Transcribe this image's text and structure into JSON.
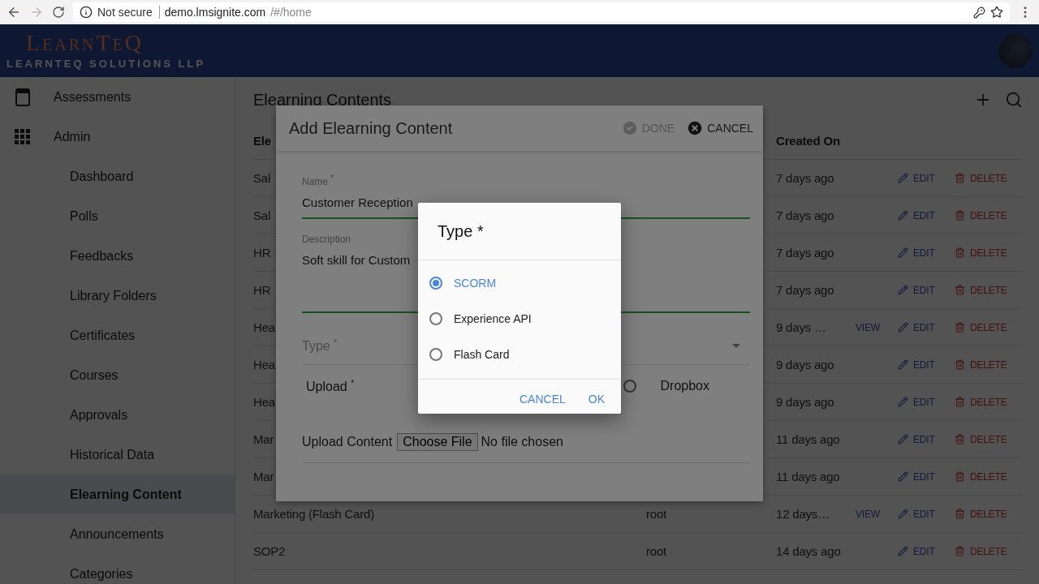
{
  "browser": {
    "security": "Not secure",
    "url_host": "demo.lmsignite.com",
    "url_path": "/#/home",
    "forward_disabled": true
  },
  "app_bar": {
    "logo": "LearnTeQ",
    "tagline": "LEARNTEQ SOLUTIONS LLP"
  },
  "sidebar": {
    "items": [
      {
        "label": "Assessments",
        "selected": false
      },
      {
        "label": "Admin",
        "selected": false,
        "children": [
          {
            "label": "Dashboard",
            "selected": false
          },
          {
            "label": "Polls",
            "selected": false
          },
          {
            "label": "Feedbacks",
            "selected": false
          },
          {
            "label": "Library Folders",
            "selected": false
          },
          {
            "label": "Certificates",
            "selected": false
          },
          {
            "label": "Courses",
            "selected": false
          },
          {
            "label": "Approvals",
            "selected": false
          },
          {
            "label": "Historical Data",
            "selected": false
          },
          {
            "label": "Elearning Content",
            "selected": true
          },
          {
            "label": "Announcements",
            "selected": false
          },
          {
            "label": "Categories",
            "selected": false
          }
        ]
      }
    ]
  },
  "page": {
    "title": "Elearning Contents",
    "table": {
      "columns": [
        {
          "label": "Ele"
        },
        {
          "label": "Created On"
        }
      ],
      "rows": [
        {
          "name": "Sal",
          "created": "7 days ago",
          "edit": "EDIT",
          "delete": "DELETE"
        },
        {
          "name": "Sal",
          "created": "7 days ago",
          "edit": "EDIT",
          "delete": "DELETE"
        },
        {
          "name": "HR",
          "created": "7 days ago",
          "edit": "EDIT",
          "delete": "DELETE"
        },
        {
          "name": "HR",
          "created": "7 days ago",
          "edit": "EDIT",
          "delete": "DELETE"
        },
        {
          "name": "Hea",
          "created": "9 days …",
          "view": "VIEW",
          "edit": "EDIT",
          "delete": "DELETE"
        },
        {
          "name": "Hea",
          "created": "9 days ago",
          "edit": "EDIT",
          "delete": "DELETE"
        },
        {
          "name": "Hea",
          "created": "9 days ago",
          "edit": "EDIT",
          "delete": "DELETE"
        },
        {
          "name": "Mar",
          "created": "11 days ago",
          "edit": "EDIT",
          "delete": "DELETE"
        },
        {
          "name": "Mar",
          "created": "11 days ago",
          "edit": "EDIT",
          "delete": "DELETE"
        },
        {
          "name": "Marketing (Flash Card)",
          "owner": "root",
          "created": "12 days…",
          "view": "VIEW",
          "edit": "EDIT",
          "delete": "DELETE"
        },
        {
          "name": "SOP2",
          "owner": "root",
          "created": "14 days ago",
          "edit": "EDIT",
          "delete": "DELETE"
        }
      ]
    }
  },
  "modal": {
    "title": "Add Elearning Content",
    "done": {
      "label": "DONE",
      "disabled": true
    },
    "cancel": {
      "label": "CANCEL"
    },
    "name": {
      "label": "Name $^{*}$",
      "value": "Customer Reception"
    },
    "description": {
      "label": "Description",
      "value": "Soft skill for Custom"
    },
    "type": {
      "placeholder": "Type $^{*}$"
    },
    "upload": {
      "label": "Upload $^{*}$",
      "option": {
        "label": "Dropbox",
        "selected": false
      }
    },
    "upload_content": {
      "label": "Upload Content",
      "button": "Choose File",
      "status": "No file chosen"
    }
  },
  "type_dialog": {
    "title": "Type *",
    "options": [
      {
        "label": "SCORM",
        "selected": true
      },
      {
        "label": "Experience API",
        "selected": false
      },
      {
        "label": "Flash Card",
        "selected": false
      }
    ],
    "buttons": [
      "CANCEL",
      "OK"
    ]
  }
}
